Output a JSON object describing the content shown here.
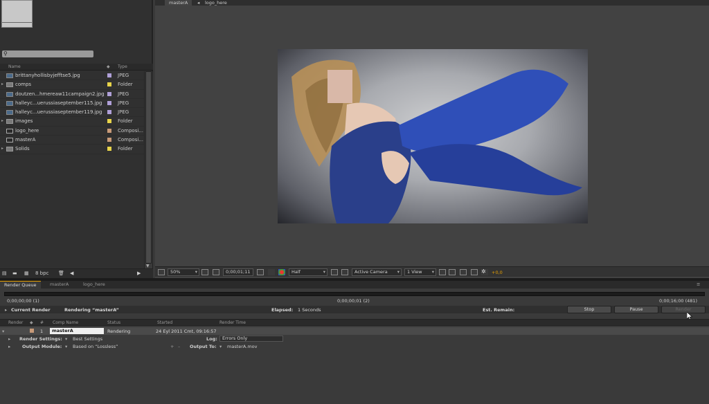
{
  "project": {
    "columns": {
      "name": "Name",
      "type": "Type"
    },
    "items": [
      {
        "name": "brittanyhollisbyjefftse5.jpg",
        "type": "JPEG",
        "kind": "image",
        "label_color": "#b0a0d8",
        "expandable": false
      },
      {
        "name": "comps",
        "type": "Folder",
        "kind": "folder",
        "label_color": "#e8d44a",
        "expandable": true
      },
      {
        "name": "doutzen...hmereaw11campaign2.jpg",
        "type": "JPEG",
        "kind": "image",
        "label_color": "#b0a0d8",
        "expandable": false
      },
      {
        "name": "halleyc...uerussiaseptember115.jpg",
        "type": "JPEG",
        "kind": "image",
        "label_color": "#b0a0d8",
        "expandable": false
      },
      {
        "name": "halleyc...uerussiaseptember119.jpg",
        "type": "JPEG",
        "kind": "image",
        "label_color": "#b0a0d8",
        "expandable": false
      },
      {
        "name": "images",
        "type": "Folder",
        "kind": "folder",
        "label_color": "#e8d44a",
        "expandable": true
      },
      {
        "name": "logo_here",
        "type": "Composi...",
        "kind": "comp",
        "label_color": "#c89a78",
        "expandable": false
      },
      {
        "name": "masterA",
        "type": "Composi...",
        "kind": "comp",
        "label_color": "#c89a78",
        "expandable": false
      },
      {
        "name": "Solids",
        "type": "Folder",
        "kind": "folder",
        "label_color": "#e8d44a",
        "expandable": true
      }
    ],
    "footer": {
      "bpc": "8 bpc"
    }
  },
  "viewer": {
    "tabs": [
      "masterA",
      "logo_here"
    ],
    "zoom": "50%",
    "timecode": "0;00;01;11",
    "resolution": "Half",
    "camera": "Active Camera",
    "views": "1 View",
    "exposure": "+0,0"
  },
  "render_queue": {
    "tabs": [
      "Render Queue",
      "masterA",
      "logo_here"
    ],
    "start_time": "0;00;00;00 (1)",
    "current_time": "0;00;00;01 (2)",
    "end_time": "0;00;16;00 (481)",
    "current_render_label": "Current Render",
    "rendering_text": "Rendering “masterA”",
    "elapsed_label": "Elapsed:",
    "elapsed_value": "1 Seconds",
    "remain_label": "Est. Remain:",
    "buttons": {
      "stop": "Stop",
      "pause": "Pause",
      "render": "Render"
    },
    "columns": {
      "render": "Render",
      "num": "#",
      "comp_name": "Comp Name",
      "status": "Status",
      "started": "Started",
      "render_time": "Render Time"
    },
    "item": {
      "number": "1",
      "comp_name": "masterA",
      "status": "Rendering",
      "started": "24 Eyl 2011 Cmt, 09:16:57",
      "label_color": "#c89a78"
    },
    "render_settings_label": "Render Settings:",
    "render_settings_value": "Best Settings",
    "log_label": "Log:",
    "log_value": "Errors Only",
    "output_module_label": "Output Module:",
    "output_module_value": "Based on “Lossless”",
    "output_to_label": "Output To:",
    "output_to_value": "masterA.mov"
  }
}
